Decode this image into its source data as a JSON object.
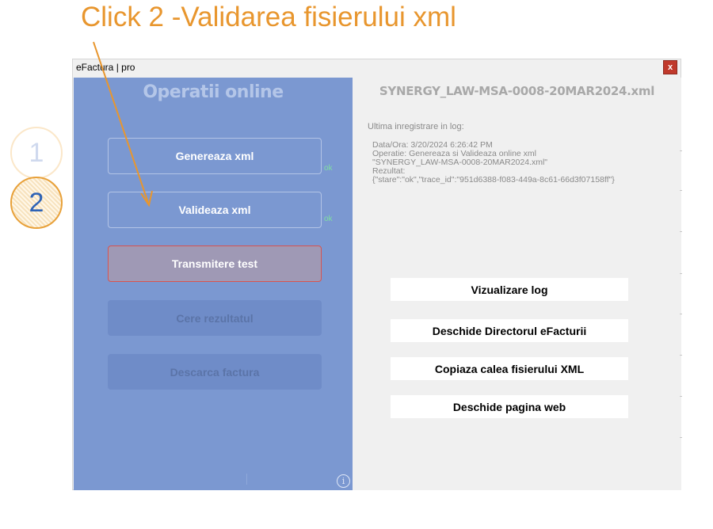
{
  "annotation": {
    "heading": "Click 2 -Validarea fisierului xml",
    "steps": [
      "1",
      "2"
    ],
    "colors": {
      "accent": "#e8962e",
      "step_active_text": "#2e63b6"
    }
  },
  "window": {
    "title": "eFactura | pro",
    "close_label": "x"
  },
  "left_panel": {
    "title": "Operatii online",
    "buttons": [
      {
        "label": "Genereaza xml",
        "status": "ok",
        "state": "enabled"
      },
      {
        "label": "Valideaza xml",
        "status": "ok",
        "state": "enabled"
      },
      {
        "label": "Transmitere test",
        "status": "",
        "state": "highlighted"
      },
      {
        "label": "Cere rezultatul",
        "status": "",
        "state": "disabled"
      },
      {
        "label": "Descarca factura",
        "status": "",
        "state": "disabled"
      }
    ],
    "info_icon": "i",
    "colors": {
      "panel_bg": "#7b98d1",
      "active_border": "#d9534f"
    }
  },
  "right_panel": {
    "file_name": "SYNERGY_LAW-MSA-0008-20MAR2024.xml",
    "log_heading": "Ultima inregistrare in log:",
    "log_lines": [
      "Data/Ora: 3/20/2024 6:26:42 PM",
      "Operatie: Genereaza si Valideaza online xml",
      "\"SYNERGY_LAW-MSA-0008-20MAR2024.xml\"",
      "Rezultat:",
      "{\"stare\":\"ok\",\"trace_id\":\"951d6388-f083-449a-8c61-66d3f07158ff\"}"
    ],
    "buttons": [
      "Vizualizare log",
      "Deschide Directorul eFacturii",
      "Copiaza calea fisierului XML",
      "Deschide pagina web"
    ]
  }
}
